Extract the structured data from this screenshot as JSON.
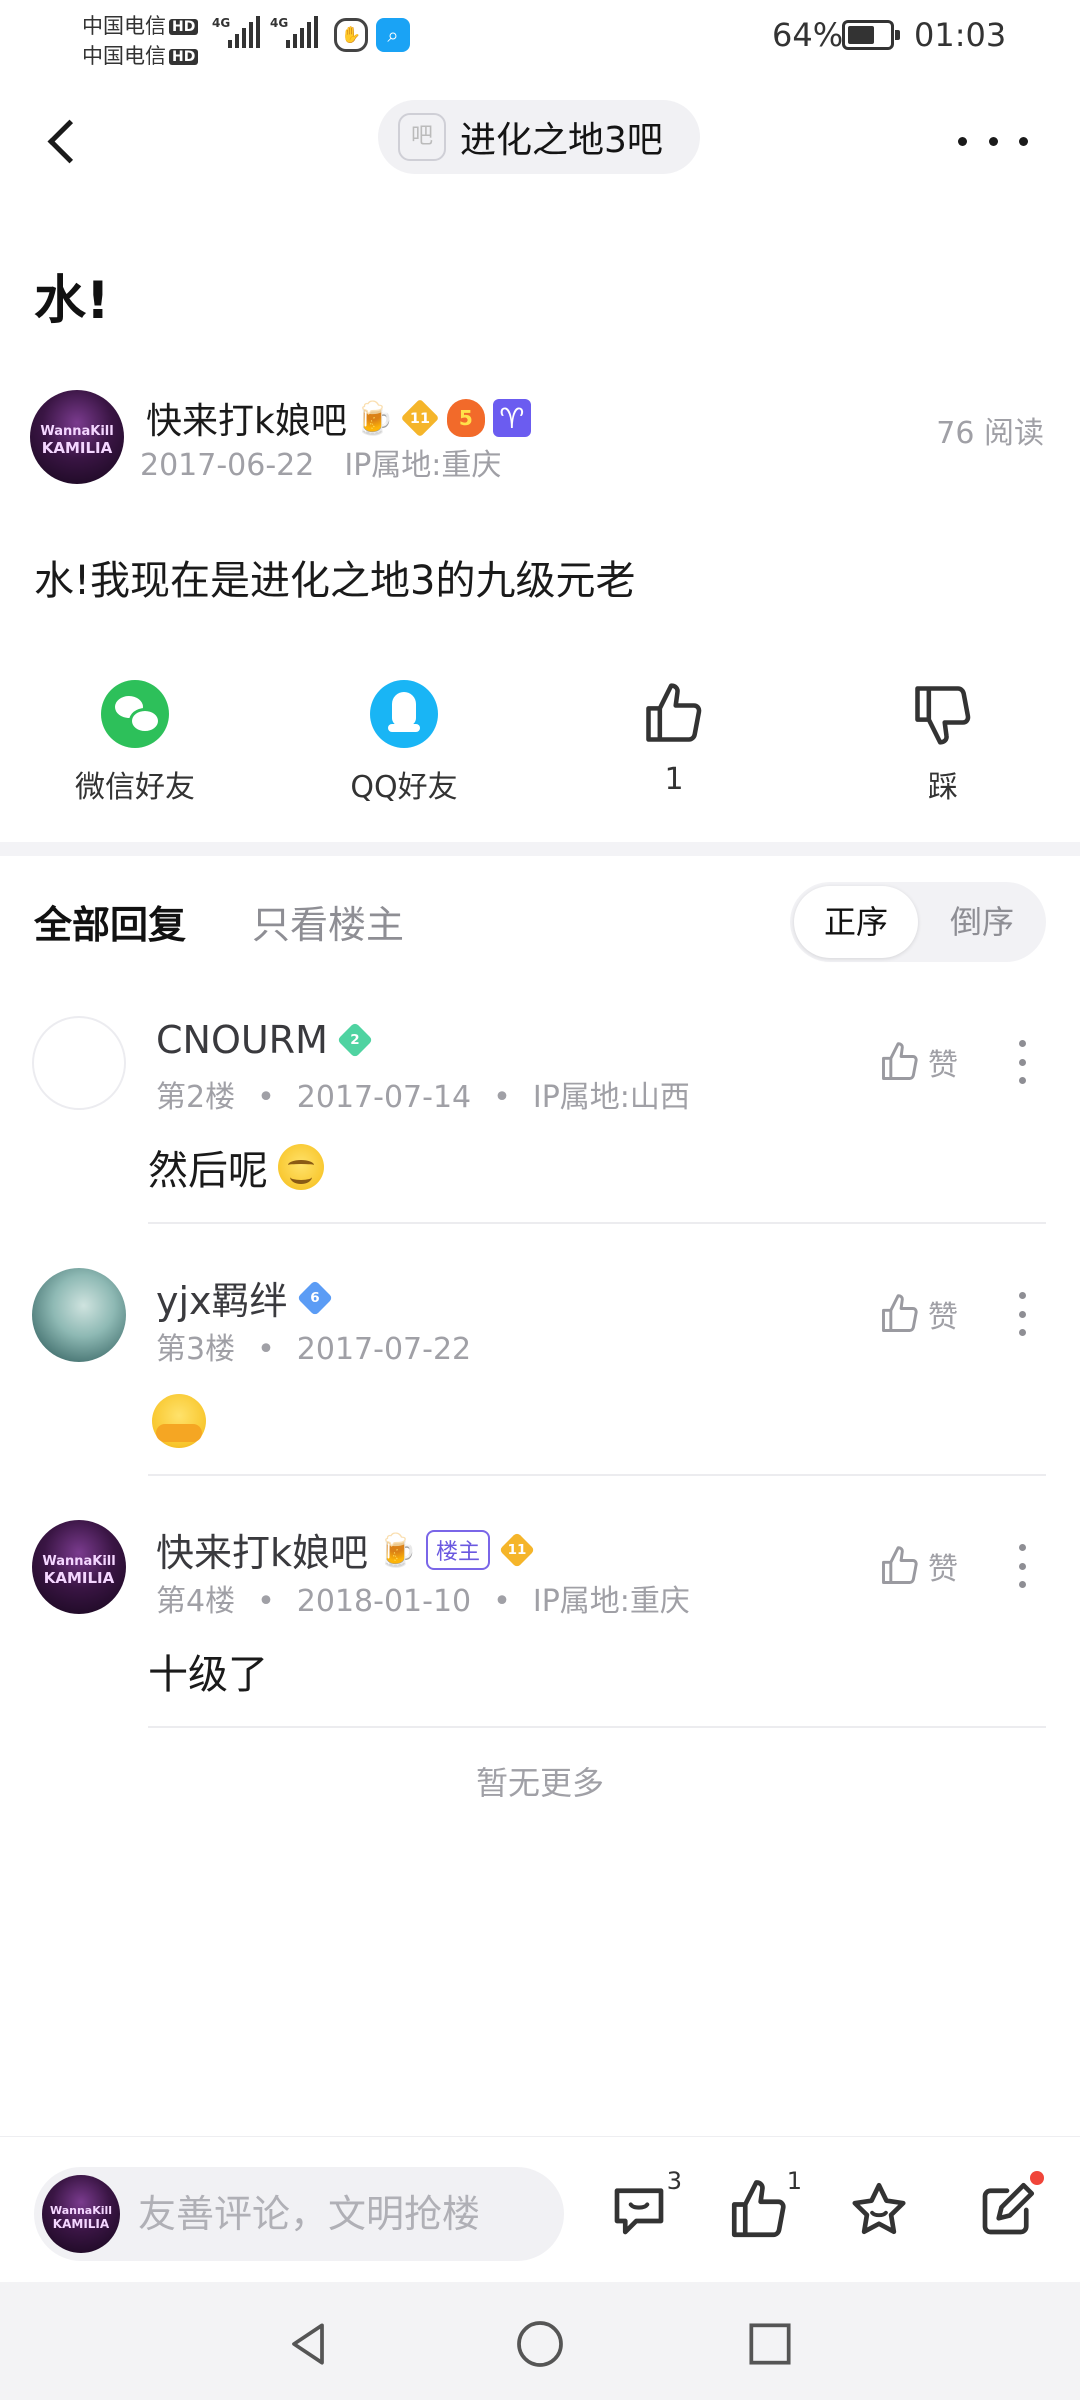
{
  "status_bar": {
    "carrier1": "中国电信",
    "carrier2": "中国电信",
    "hd": "HD",
    "network": "4G",
    "battery_percent": "64%",
    "battery_level": 0.64,
    "time": "01:03"
  },
  "nav": {
    "forum_icon_text": "吧",
    "forum_name": "进化之地3吧"
  },
  "post": {
    "title": "水!",
    "author": "快来打k娘吧",
    "author_badges": [
      "beer-icon",
      "level-11-badge",
      "game-level-5-badge",
      "aries-icon"
    ],
    "level_badge": "11",
    "game_badge": "5",
    "zodiac": "♈",
    "date": "2017-06-22",
    "ip_location": "IP属地:重庆",
    "read_count": "76 阅读",
    "avatar_text_1": "WannaKill",
    "avatar_text_2": "KAMILIA",
    "body": "水!我现在是进化之地3的九级元老"
  },
  "share": {
    "wechat_label": "微信好友",
    "qq_label": "QQ好友",
    "like_count": "1",
    "dislike_label": "踩"
  },
  "reply_tabs": {
    "all_label": "全部回复",
    "op_only_label": "只看楼主",
    "order_asc": "正序",
    "order_desc": "倒序"
  },
  "replies": [
    {
      "user": "CNOURM",
      "gem_level": "2",
      "floor": "第2楼",
      "date": "2017-07-14",
      "ip": "IP属地:山西",
      "content": "然后呢",
      "like_label": "赞"
    },
    {
      "user": "yjx羁绊",
      "gem_level": "6",
      "floor": "第3楼",
      "date": "2017-07-22",
      "ip": "",
      "content": "",
      "like_label": "赞"
    },
    {
      "user": "快来打k娘吧",
      "owner_tag": "楼主",
      "gem_level": "11",
      "floor": "第4楼",
      "date": "2018-01-10",
      "ip": "IP属地:重庆",
      "content": "十级了",
      "like_label": "赞"
    }
  ],
  "separator_dot": "•",
  "no_more": "暂无更多",
  "bottom_bar": {
    "comment_placeholder": "友善评论，文明抢楼",
    "comment_count": "3",
    "like_count": "1"
  }
}
